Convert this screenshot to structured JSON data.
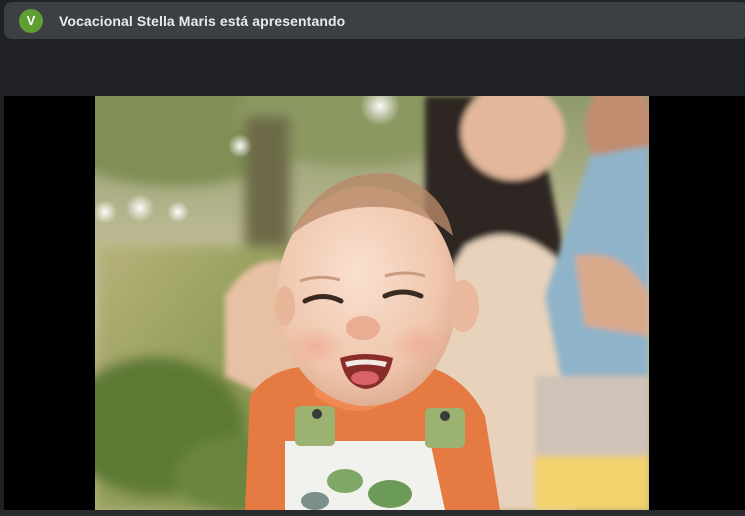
{
  "presenter_banner": {
    "avatar_initial": "V",
    "avatar_color": "#5f9e31",
    "text": "Vocacional Stella Maris está apresentando"
  },
  "shared_content": {
    "image_subject": "smiling-baby-photo-icon"
  }
}
